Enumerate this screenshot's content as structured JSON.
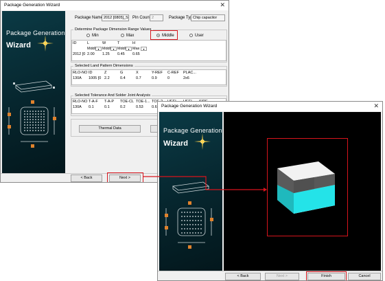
{
  "back_window": {
    "title": "Package Generation Wizard",
    "close_icon": "close-icon",
    "side": {
      "line1": "Package Generation",
      "line2": "Wizard"
    },
    "package_name_label": "Package Name",
    "package_name_value": "2012 [0805]_SS",
    "pin_count_label": "Pin Count",
    "pin_count_value": "2",
    "package_type_label": "Package Type",
    "package_type_value": "Chip capacitor",
    "range": {
      "title": "Determine Package Dimension Range Values",
      "min_label": "Min",
      "max_label": "Max",
      "middle_label": "Middle",
      "user_label": "User",
      "headers": [
        "ID",
        "L",
        "W",
        "T",
        "H"
      ],
      "subheaders": [
        "",
        "Mddl",
        "Mddl",
        "Mddl",
        "Max"
      ],
      "row": [
        "2012 [0",
        "2.00",
        "1.25",
        "0.45",
        "0.65"
      ]
    },
    "land": {
      "title": "Selected Land Pattern Dimensions",
      "headers": [
        "RLO-NO",
        "ID",
        "Z",
        "G",
        "X",
        "Y-REF",
        "C-REF",
        "PLAC..."
      ],
      "row": [
        "130A",
        "1005 [0",
        "2.2",
        "0.4",
        "0.7",
        "0.9",
        "0",
        "2x6"
      ]
    },
    "tol": {
      "title": "Selected Tolerance And Solder Joint Analysis",
      "headers": [
        "RLO-NO",
        "T-A-F",
        "T-A-P",
        "TOE-CL",
        "TOE-1...",
        "TOE-2...",
        "HEEL",
        "HEEL",
        "SIDE"
      ],
      "row": [
        "130A",
        "0.1",
        "0.1",
        "0.2",
        "0.53",
        "0.65"
      ]
    },
    "thermal_button": "Thermal Data",
    "back_button": "< Back",
    "next_button": "Next >"
  },
  "front_window": {
    "title": "Package Generation Wizard",
    "close_icon": "close-icon",
    "side": {
      "line1": "Package Generation",
      "line2": "Wizard"
    },
    "back_button": "< Back",
    "next_button": "Next >",
    "finish_button": "Finish",
    "cancel_button": "Cancel"
  },
  "colors": {
    "highlight_red": "#d8141c",
    "panel_teal": "#0b3a45",
    "component_cyan": "#22e6ea"
  }
}
